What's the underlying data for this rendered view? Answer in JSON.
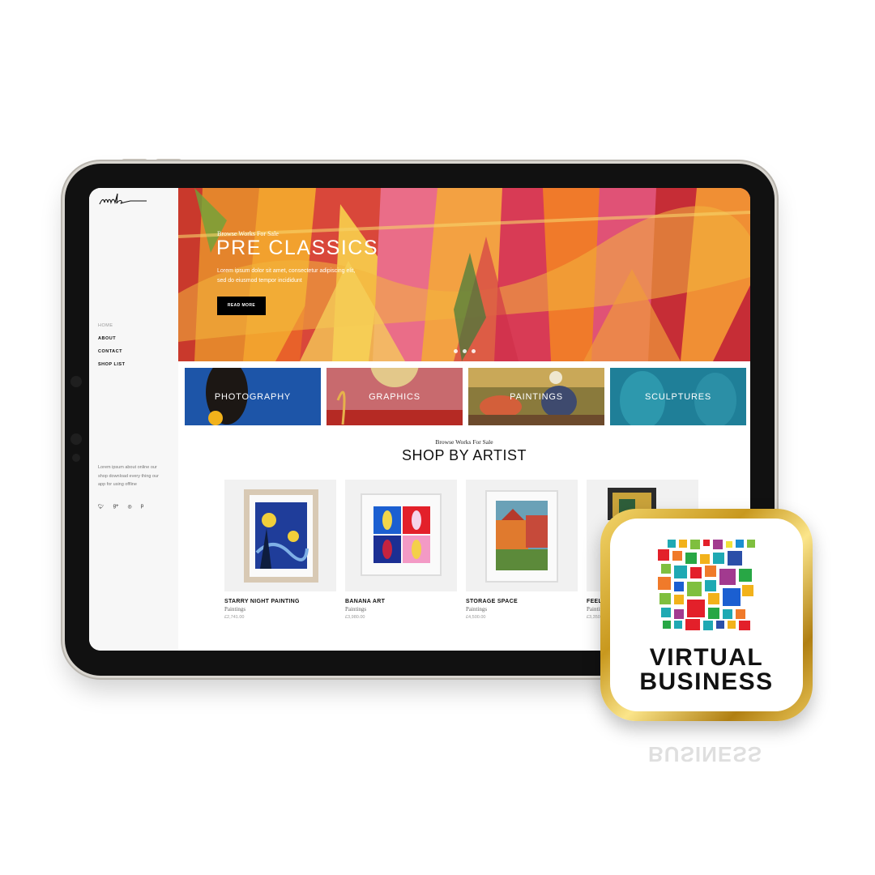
{
  "sidebar": {
    "nav": [
      "HOME",
      "ABOUT",
      "CONTACT",
      "SHOP LIST"
    ],
    "about_text": "Lorem ipsum about online our shop download every thing our app for using offline",
    "social": [
      "twitter-icon",
      "google-plus-icon",
      "dribbble-icon",
      "pinterest-icon"
    ]
  },
  "hero": {
    "kicker": "Browse Works For Sale",
    "title": "PRE CLASSICS",
    "text": "Lorem ipsum dolor sit amet, consectetur adipiscing elit, sed do eiusmod tempor incididunt",
    "button": "READ MORE",
    "slide_count": 3
  },
  "categories": [
    "PHOTOGRAPHY",
    "GRAPHICS",
    "PAINTINGS",
    "SCULPTURES"
  ],
  "shop": {
    "kicker": "Browse Works For Sale",
    "title": "SHOP BY ARTIST",
    "products": [
      {
        "name": "STARRY NIGHT PAINTING",
        "category": "Paintings",
        "price": "£2,741.00"
      },
      {
        "name": "BANANA ART",
        "category": "Paintings",
        "price": "£3,980.00"
      },
      {
        "name": "STORAGE SPACE",
        "category": "Paintings",
        "price": "£4,500.00"
      },
      {
        "name": "FEEL",
        "category": "Paintings",
        "price": "£3,350"
      }
    ]
  },
  "badge": {
    "line1": "VIRTUAL",
    "line2": "BUSINESS",
    "reflection": "BUSINESS"
  },
  "colors": {
    "accent_black": "#000000",
    "gold": "#c8981e"
  }
}
